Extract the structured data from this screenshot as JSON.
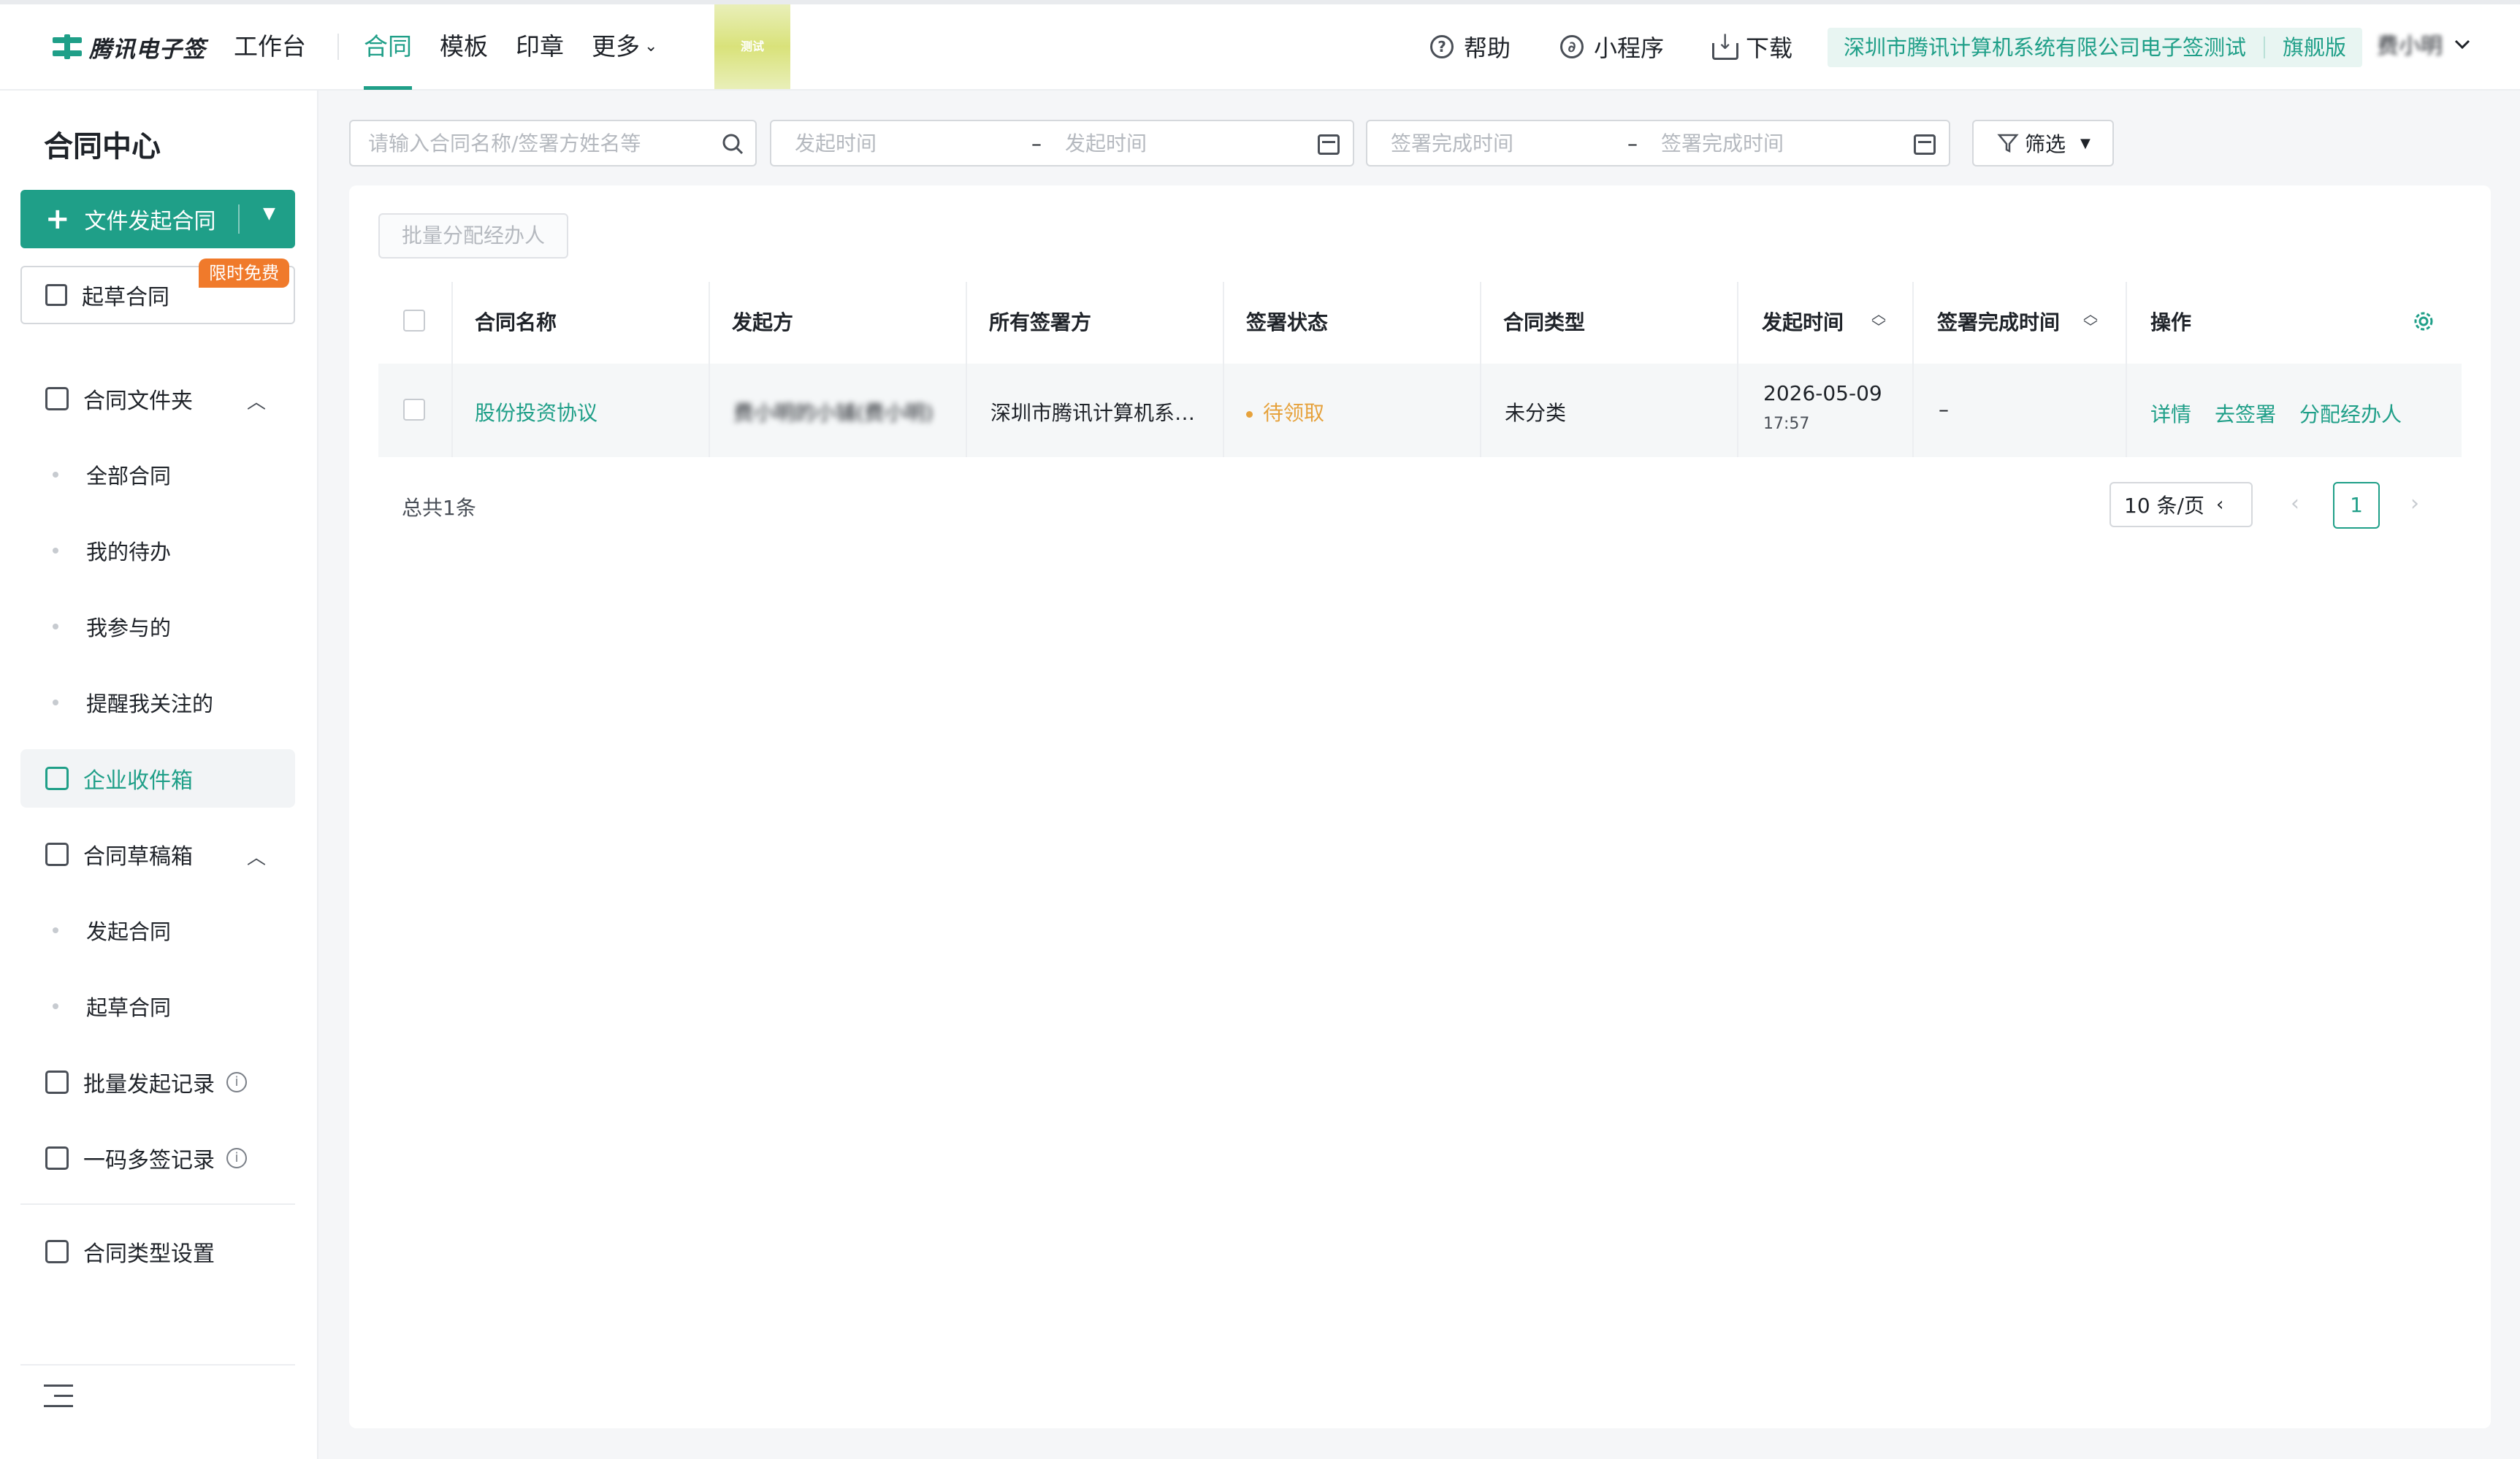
{
  "brand": {
    "name": "腾讯电子签"
  },
  "nav": {
    "items": [
      "工作台",
      "合同",
      "模板",
      "印章",
      "更多"
    ],
    "active": "合同",
    "test_badge": "测试"
  },
  "top_right": {
    "help": "帮助",
    "mini_program": "小程序",
    "download": "下载",
    "company": "深圳市腾讯计算机系统有限公司电子签测试",
    "edition": "旗舰版",
    "user": "费小明"
  },
  "sidebar": {
    "title": "合同中心",
    "primary_button": "文件发起合同",
    "draft_button": "起草合同",
    "free_badge": "限时免费",
    "folder": {
      "label": "合同文件夹",
      "children": [
        "全部合同",
        "我的待办",
        "我参与的",
        "提醒我关注的"
      ]
    },
    "inbox": "企业收件箱",
    "drafts": {
      "label": "合同草稿箱",
      "children": [
        "发起合同",
        "起草合同"
      ]
    },
    "batch_records": "批量发起记录",
    "qr_records": "一码多签记录",
    "type_settings": "合同类型设置"
  },
  "filters": {
    "search_placeholder": "请输入合同名称/签署方姓名等",
    "start_placeholder_from": "发起时间",
    "start_placeholder_to": "发起时间",
    "complete_placeholder_from": "签署完成时间",
    "complete_placeholder_to": "签署完成时间",
    "range_sep": "–",
    "filter_button": "筛选"
  },
  "toolbar": {
    "batch_assign": "批量分配经办人"
  },
  "table": {
    "columns": [
      "合同名称",
      "发起方",
      "所有签署方",
      "签署状态",
      "合同类型",
      "发起时间",
      "签署完成时间",
      "操作"
    ],
    "rows": [
      {
        "name": "股份投资协议",
        "initiator": "费小明的小铺(费小明)",
        "signers": "深圳市腾讯计算机系…",
        "status": "待领取",
        "type": "未分类",
        "start_date": "2026-05-09",
        "start_time": "17:57",
        "complete_time": "–",
        "actions": [
          "详情",
          "去签署",
          "分配经办人"
        ]
      }
    ]
  },
  "pagination": {
    "total": "总共1条",
    "page_size": "10 条/页",
    "current": "1"
  },
  "colors": {
    "accent": "#1f9f88",
    "status_pending": "#e6a23c",
    "badge": "#f07a2b"
  }
}
